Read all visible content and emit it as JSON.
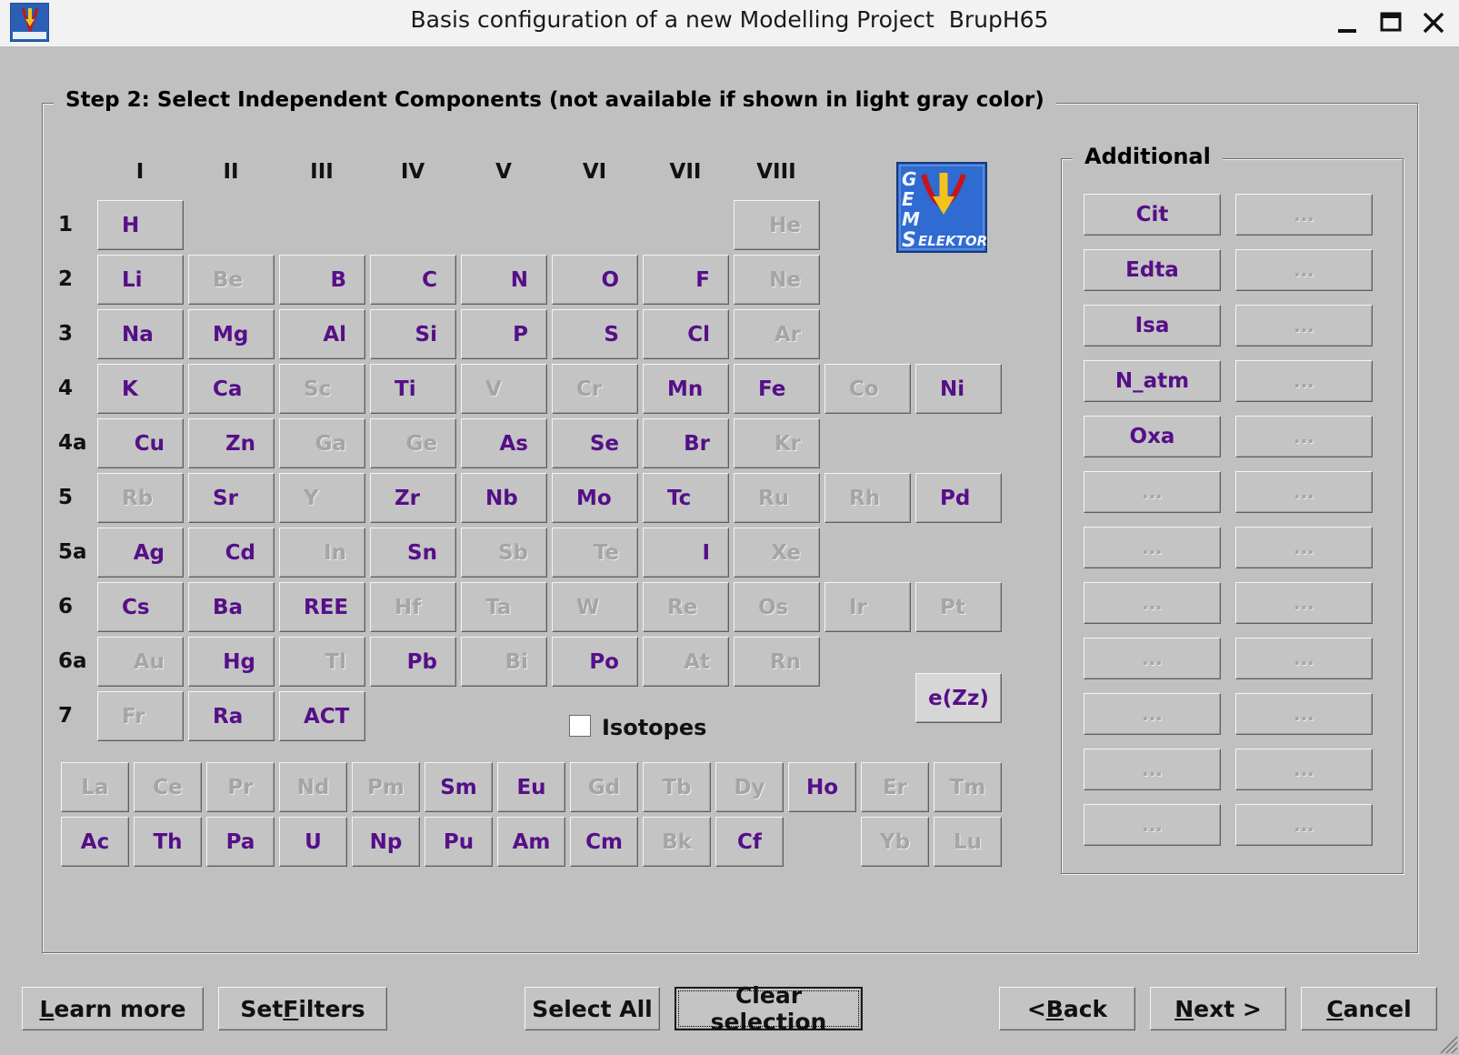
{
  "window": {
    "title": "Basis configuration of a new Modelling Project  BrupH65",
    "app_icon": "gems-selektor-icon",
    "controls": [
      "minimize-icon",
      "maximize-icon",
      "close-icon"
    ]
  },
  "step": {
    "title": "Step 2: Select Independent Components (not available if shown in light gray color)"
  },
  "groups": [
    "I",
    "II",
    "III",
    "IV",
    "V",
    "VI",
    "VII",
    "VIII"
  ],
  "periods": [
    "1",
    "2",
    "3",
    "4",
    "4a",
    "5",
    "5a",
    "6",
    "6a",
    "7"
  ],
  "element_rows": [
    [
      {
        "s": "H",
        "on": true,
        "c": 0
      },
      {
        "s": "He",
        "on": false,
        "c": 7,
        "a": "right"
      }
    ],
    [
      {
        "s": "Li",
        "on": true,
        "c": 0
      },
      {
        "s": "Be",
        "on": false,
        "c": 1
      },
      {
        "s": "B",
        "on": true,
        "c": 2,
        "a": "right"
      },
      {
        "s": "C",
        "on": true,
        "c": 3,
        "a": "right"
      },
      {
        "s": "N",
        "on": true,
        "c": 4,
        "a": "right"
      },
      {
        "s": "O",
        "on": true,
        "c": 5,
        "a": "right"
      },
      {
        "s": "F",
        "on": true,
        "c": 6,
        "a": "right"
      },
      {
        "s": "Ne",
        "on": false,
        "c": 7,
        "a": "right"
      }
    ],
    [
      {
        "s": "Na",
        "on": true,
        "c": 0
      },
      {
        "s": "Mg",
        "on": true,
        "c": 1
      },
      {
        "s": "Al",
        "on": true,
        "c": 2,
        "a": "right"
      },
      {
        "s": "Si",
        "on": true,
        "c": 3,
        "a": "right"
      },
      {
        "s": "P",
        "on": true,
        "c": 4,
        "a": "right"
      },
      {
        "s": "S",
        "on": true,
        "c": 5,
        "a": "right"
      },
      {
        "s": "Cl",
        "on": true,
        "c": 6,
        "a": "right"
      },
      {
        "s": "Ar",
        "on": false,
        "c": 7,
        "a": "right"
      }
    ],
    [
      {
        "s": "K",
        "on": true,
        "c": 0
      },
      {
        "s": "Ca",
        "on": true,
        "c": 1
      },
      {
        "s": "Sc",
        "on": false,
        "c": 2
      },
      {
        "s": "Ti",
        "on": true,
        "c": 3
      },
      {
        "s": "V",
        "on": false,
        "c": 4
      },
      {
        "s": "Cr",
        "on": false,
        "c": 5
      },
      {
        "s": "Mn",
        "on": true,
        "c": 6
      },
      {
        "s": "Fe",
        "on": true,
        "c": 7
      },
      {
        "s": "Co",
        "on": false,
        "c": 8
      },
      {
        "s": "Ni",
        "on": true,
        "c": 9
      }
    ],
    [
      {
        "s": "Cu",
        "on": true,
        "c": 0,
        "a": "right"
      },
      {
        "s": "Zn",
        "on": true,
        "c": 1,
        "a": "right"
      },
      {
        "s": "Ga",
        "on": false,
        "c": 2,
        "a": "right"
      },
      {
        "s": "Ge",
        "on": false,
        "c": 3,
        "a": "right"
      },
      {
        "s": "As",
        "on": true,
        "c": 4,
        "a": "right"
      },
      {
        "s": "Se",
        "on": true,
        "c": 5,
        "a": "right"
      },
      {
        "s": "Br",
        "on": true,
        "c": 6,
        "a": "right"
      },
      {
        "s": "Kr",
        "on": false,
        "c": 7,
        "a": "right"
      }
    ],
    [
      {
        "s": "Rb",
        "on": false,
        "c": 0
      },
      {
        "s": "Sr",
        "on": true,
        "c": 1
      },
      {
        "s": "Y",
        "on": false,
        "c": 2
      },
      {
        "s": "Zr",
        "on": true,
        "c": 3
      },
      {
        "s": "Nb",
        "on": true,
        "c": 4
      },
      {
        "s": "Mo",
        "on": true,
        "c": 5
      },
      {
        "s": "Tc",
        "on": true,
        "c": 6
      },
      {
        "s": "Ru",
        "on": false,
        "c": 7
      },
      {
        "s": "Rh",
        "on": false,
        "c": 8
      },
      {
        "s": "Pd",
        "on": true,
        "c": 9
      }
    ],
    [
      {
        "s": "Ag",
        "on": true,
        "c": 0,
        "a": "right"
      },
      {
        "s": "Cd",
        "on": true,
        "c": 1,
        "a": "right"
      },
      {
        "s": "In",
        "on": false,
        "c": 2,
        "a": "right"
      },
      {
        "s": "Sn",
        "on": true,
        "c": 3,
        "a": "right"
      },
      {
        "s": "Sb",
        "on": false,
        "c": 4,
        "a": "right"
      },
      {
        "s": "Te",
        "on": false,
        "c": 5,
        "a": "right"
      },
      {
        "s": "I",
        "on": true,
        "c": 6,
        "a": "right"
      },
      {
        "s": "Xe",
        "on": false,
        "c": 7,
        "a": "right"
      }
    ],
    [
      {
        "s": "Cs",
        "on": true,
        "c": 0
      },
      {
        "s": "Ba",
        "on": true,
        "c": 1
      },
      {
        "s": "REE",
        "on": true,
        "c": 2
      },
      {
        "s": "Hf",
        "on": false,
        "c": 3
      },
      {
        "s": "Ta",
        "on": false,
        "c": 4
      },
      {
        "s": "W",
        "on": false,
        "c": 5
      },
      {
        "s": "Re",
        "on": false,
        "c": 6
      },
      {
        "s": "Os",
        "on": false,
        "c": 7
      },
      {
        "s": "Ir",
        "on": false,
        "c": 8
      },
      {
        "s": "Pt",
        "on": false,
        "c": 9
      }
    ],
    [
      {
        "s": "Au",
        "on": false,
        "c": 0,
        "a": "right"
      },
      {
        "s": "Hg",
        "on": true,
        "c": 1,
        "a": "right"
      },
      {
        "s": "Tl",
        "on": false,
        "c": 2,
        "a": "right"
      },
      {
        "s": "Pb",
        "on": true,
        "c": 3,
        "a": "right"
      },
      {
        "s": "Bi",
        "on": false,
        "c": 4,
        "a": "right"
      },
      {
        "s": "Po",
        "on": true,
        "c": 5,
        "a": "right"
      },
      {
        "s": "At",
        "on": false,
        "c": 6,
        "a": "right"
      },
      {
        "s": "Rn",
        "on": false,
        "c": 7,
        "a": "right"
      }
    ],
    [
      {
        "s": "Fr",
        "on": false,
        "c": 0
      },
      {
        "s": "Ra",
        "on": true,
        "c": 1
      },
      {
        "s": "ACT",
        "on": true,
        "c": 2
      }
    ]
  ],
  "lanthanides": [
    {
      "s": "La",
      "on": false
    },
    {
      "s": "Ce",
      "on": false
    },
    {
      "s": "Pr",
      "on": false
    },
    {
      "s": "Nd",
      "on": false
    },
    {
      "s": "Pm",
      "on": false
    },
    {
      "s": "Sm",
      "on": true
    },
    {
      "s": "Eu",
      "on": true
    },
    {
      "s": "Gd",
      "on": false
    },
    {
      "s": "Tb",
      "on": false
    },
    {
      "s": "Dy",
      "on": false
    },
    {
      "s": "Ho",
      "on": true
    },
    {
      "s": "Er",
      "on": false
    },
    {
      "s": "Tm",
      "on": false
    }
  ],
  "actinides": [
    {
      "s": "Ac",
      "on": true,
      "c": 0
    },
    {
      "s": "Th",
      "on": true,
      "c": 1
    },
    {
      "s": "Pa",
      "on": true,
      "c": 2
    },
    {
      "s": "U",
      "on": true,
      "c": 3
    },
    {
      "s": "Np",
      "on": true,
      "c": 4
    },
    {
      "s": "Pu",
      "on": true,
      "c": 5
    },
    {
      "s": "Am",
      "on": true,
      "c": 6
    },
    {
      "s": "Cm",
      "on": true,
      "c": 7
    },
    {
      "s": "Bk",
      "on": false,
      "c": 8
    },
    {
      "s": "Cf",
      "on": true,
      "c": 9
    },
    {
      "s": "Yb",
      "on": false,
      "c": 11
    },
    {
      "s": "Lu",
      "on": false,
      "c": 12
    }
  ],
  "electron_button": {
    "label": "e(Zz)",
    "on": true
  },
  "isotopes": {
    "label": "Isotopes",
    "checked": false
  },
  "additional": {
    "title": "Additional",
    "left": [
      {
        "s": "Cit",
        "on": true
      },
      {
        "s": "Edta",
        "on": true
      },
      {
        "s": "Isa",
        "on": true
      },
      {
        "s": "N_atm",
        "on": true
      },
      {
        "s": "Oxa",
        "on": true
      },
      {
        "s": "...",
        "on": false
      },
      {
        "s": "...",
        "on": false
      },
      {
        "s": "...",
        "on": false
      },
      {
        "s": "...",
        "on": false
      },
      {
        "s": "...",
        "on": false
      },
      {
        "s": "...",
        "on": false
      },
      {
        "s": "...",
        "on": false
      }
    ],
    "right": [
      {
        "s": "...",
        "on": false
      },
      {
        "s": "...",
        "on": false
      },
      {
        "s": "...",
        "on": false
      },
      {
        "s": "...",
        "on": false
      },
      {
        "s": "...",
        "on": false
      },
      {
        "s": "...",
        "on": false
      },
      {
        "s": "...",
        "on": false
      },
      {
        "s": "...",
        "on": false
      },
      {
        "s": "...",
        "on": false
      },
      {
        "s": "...",
        "on": false
      },
      {
        "s": "...",
        "on": false
      },
      {
        "s": "...",
        "on": false
      }
    ]
  },
  "buttons": {
    "learn_more": {
      "pre": "",
      "mn": "L",
      "post": "earn more"
    },
    "set_filters": {
      "pre": "Set ",
      "mn": "F",
      "post": "ilters"
    },
    "select_all": {
      "pre": "Select All",
      "mn": "",
      "post": ""
    },
    "clear_selection": {
      "pre": "Clear selection",
      "mn": "",
      "post": ""
    },
    "back": {
      "pre": "< ",
      "mn": "B",
      "post": "ack"
    },
    "next": {
      "pre": "",
      "mn": "N",
      "post": "ext >"
    },
    "cancel": {
      "pre": "",
      "mn": "C",
      "post": "ancel"
    }
  },
  "colors": {
    "available": "#560f88",
    "unavailable": "#a5a5a5",
    "dialog_bg": "#c0c0c0",
    "titlebar_bg": "#f2f2f2"
  }
}
